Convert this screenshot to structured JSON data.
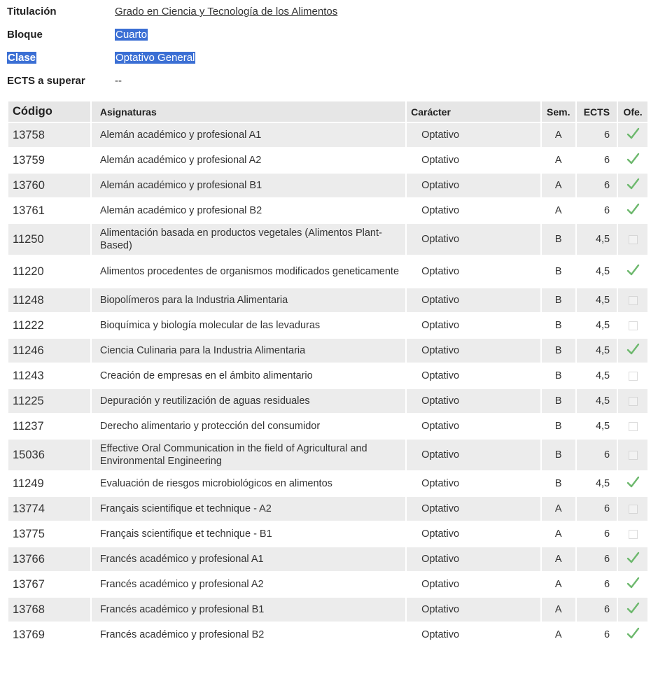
{
  "info": {
    "titulacion_label": "Titulación",
    "titulacion_value": "Grado en Ciencia y Tecnología de los Alimentos",
    "bloque_label": "Bloque",
    "bloque_value": "Cuarto",
    "clase_label": "Clase",
    "clase_value": "Optativo General",
    "ects_label": "ECTS a superar",
    "ects_value": "--"
  },
  "table": {
    "headers": {
      "codigo": "Código",
      "asignaturas": "Asignaturas",
      "caracter": "Carácter",
      "sem": "Sem.",
      "ects": "ECTS",
      "ofe": "Ofe."
    },
    "rows": [
      {
        "code": "13758",
        "name": "Alemán académico y profesional A1",
        "caracter": "Optativo",
        "sem": "A",
        "ects": "6",
        "offered": true
      },
      {
        "code": "13759",
        "name": "Alemán académico y profesional A2",
        "caracter": "Optativo",
        "sem": "A",
        "ects": "6",
        "offered": true
      },
      {
        "code": "13760",
        "name": "Alemán académico y profesional B1",
        "caracter": "Optativo",
        "sem": "A",
        "ects": "6",
        "offered": true
      },
      {
        "code": "13761",
        "name": "Alemán académico y profesional B2",
        "caracter": "Optativo",
        "sem": "A",
        "ects": "6",
        "offered": true
      },
      {
        "code": "11250",
        "name": "Alimentación basada en productos vegetales (Alimentos Plant-Based)",
        "caracter": "Optativo",
        "sem": "B",
        "ects": "4,5",
        "offered": false
      },
      {
        "code": "11220",
        "name": "Alimentos procedentes de organismos modificados geneticamente",
        "caracter": "Optativo",
        "sem": "B",
        "ects": "4,5",
        "offered": true
      },
      {
        "code": "11248",
        "name": "Biopolímeros para la Industria Alimentaria",
        "caracter": "Optativo",
        "sem": "B",
        "ects": "4,5",
        "offered": false
      },
      {
        "code": "11222",
        "name": "Bioquímica y biología molecular de las levaduras",
        "caracter": "Optativo",
        "sem": "B",
        "ects": "4,5",
        "offered": false
      },
      {
        "code": "11246",
        "name": "Ciencia Culinaria para la Industria Alimentaria",
        "caracter": "Optativo",
        "sem": "B",
        "ects": "4,5",
        "offered": true
      },
      {
        "code": "11243",
        "name": "Creación de empresas en el ámbito alimentario",
        "caracter": "Optativo",
        "sem": "B",
        "ects": "4,5",
        "offered": false
      },
      {
        "code": "11225",
        "name": "Depuración y reutilización de aguas residuales",
        "caracter": "Optativo",
        "sem": "B",
        "ects": "4,5",
        "offered": false
      },
      {
        "code": "11237",
        "name": "Derecho alimentario y protección del consumidor",
        "caracter": "Optativo",
        "sem": "B",
        "ects": "4,5",
        "offered": false
      },
      {
        "code": "15036",
        "name": "Effective Oral Communication in the field of Agricultural and Environmental Engineering",
        "caracter": "Optativo",
        "sem": "B",
        "ects": "6",
        "offered": false
      },
      {
        "code": "11249",
        "name": "Evaluación de riesgos microbiológicos en alimentos",
        "caracter": "Optativo",
        "sem": "B",
        "ects": "4,5",
        "offered": true
      },
      {
        "code": "13774",
        "name": "Français scientifique et technique - A2",
        "caracter": "Optativo",
        "sem": "A",
        "ects": "6",
        "offered": false
      },
      {
        "code": "13775",
        "name": "Français scientifique et technique - B1",
        "caracter": "Optativo",
        "sem": "A",
        "ects": "6",
        "offered": false
      },
      {
        "code": "13766",
        "name": "Francés académico y profesional A1",
        "caracter": "Optativo",
        "sem": "A",
        "ects": "6",
        "offered": true
      },
      {
        "code": "13767",
        "name": "Francés académico y profesional A2",
        "caracter": "Optativo",
        "sem": "A",
        "ects": "6",
        "offered": true
      },
      {
        "code": "13768",
        "name": "Francés académico y profesional B1",
        "caracter": "Optativo",
        "sem": "A",
        "ects": "6",
        "offered": true
      },
      {
        "code": "13769",
        "name": "Francés académico y profesional B2",
        "caracter": "Optativo",
        "sem": "A",
        "ects": "6",
        "offered": true
      }
    ]
  },
  "colors": {
    "highlight": "#3b6fd4",
    "check": "#6db86d",
    "row_alt": "#ececec",
    "header_bg": "#e6e6e6"
  }
}
